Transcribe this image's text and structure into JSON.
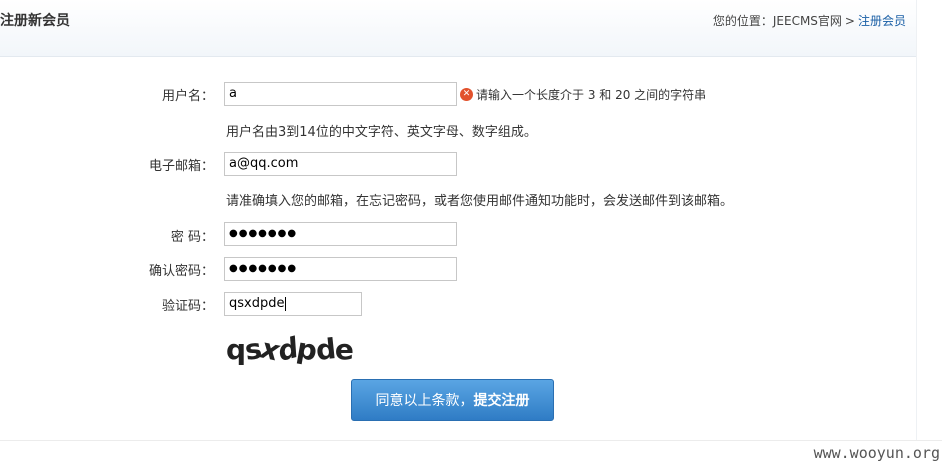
{
  "header": {
    "title": "注册新会员",
    "breadcrumb_prefix": "您的位置：",
    "breadcrumb_home": "JEECMS官网",
    "breadcrumb_sep": ">",
    "breadcrumb_current": "注册会员"
  },
  "form": {
    "username": {
      "label": "用户名：",
      "value": "a",
      "error": "请输入一个长度介于 3 和 20 之间的字符串",
      "hint": "用户名由3到14位的中文字符、英文字母、数字组成。"
    },
    "email": {
      "label": "电子邮箱：",
      "value": "a@qq.com",
      "hint": "请准确填入您的邮箱，在忘记密码，或者您使用邮件通知功能时，会发送邮件到该邮箱。"
    },
    "password": {
      "label": "密 码：",
      "masked": "●●●●●●●"
    },
    "confirm": {
      "label": "确认密码：",
      "masked": "●●●●●●●"
    },
    "captcha": {
      "label": "验证码：",
      "value": "qsxdpde",
      "image_text": "qsxdpde"
    },
    "submit": {
      "normal": "同意以上条款，",
      "bold": "提交注册"
    }
  },
  "error_icon": "error-x-icon",
  "watermark": "www.wooyun.org"
}
